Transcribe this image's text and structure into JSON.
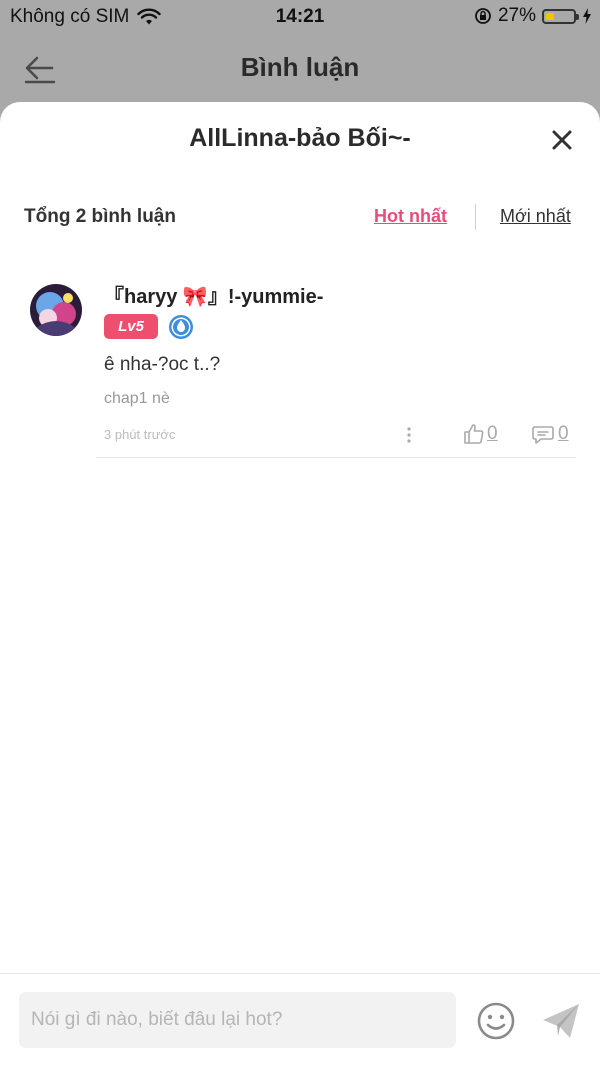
{
  "status": {
    "carrier": "Không có SIM",
    "time": "14:21",
    "battery": "27%"
  },
  "appbar": {
    "title": "Bình luận"
  },
  "sheet": {
    "title": "AllLinna-bảo Bối~-"
  },
  "comments_header": {
    "total": "Tổng 2 bình luận",
    "sort_hot": "Hot nhất",
    "sort_new": "Mới nhất"
  },
  "comment": {
    "username": "『haryy 🎀』!-yummie-",
    "level": "Lv5",
    "text": "ê nha-?oc t..?",
    "subtext": "chap1 nè",
    "time": "3 phút trước",
    "likes": "0",
    "replies": "0"
  },
  "composer": {
    "placeholder": "Nói gì đi nào, biết đâu lại hot?"
  },
  "colors": {
    "accent": "#ec4a7a",
    "level_badge": "#ef4f6f",
    "verified_badge": "#3b8fe0"
  }
}
